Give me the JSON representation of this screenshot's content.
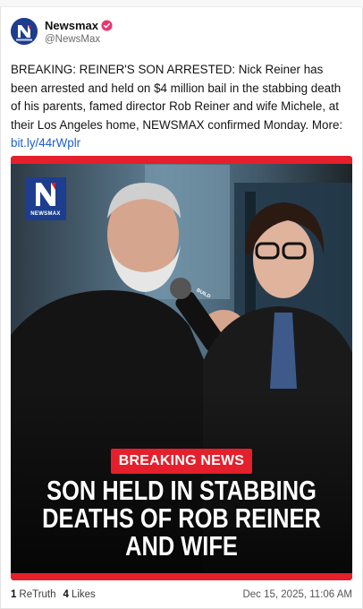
{
  "account": {
    "display_name": "Newsmax",
    "handle": "@NewsMax",
    "avatar_icon": "newsmax-n-logo",
    "verified_icon": "verified-badge-icon",
    "brand_color": "#1d3d8f",
    "verified_color": "#e8366f"
  },
  "post": {
    "text": "BREAKING: REINER'S SON ARRESTED: Nick Reiner has been arrested and held on $4 million bail in the stabbing death of his parents, famed director Rob Reiner and wife Michele, at their Los Angeles home, NEWSMAX confirmed Monday. More:",
    "link": "bit.ly/44rWplr",
    "link_color": "#1f5fd1"
  },
  "media": {
    "logo_text": "NEWSMAX",
    "mic_text": "BUILD",
    "badge": "BREAKING NEWS",
    "headline_lines": [
      "SON HELD IN STABBING",
      "DEATHS OF ROB REINER",
      "AND WIFE"
    ],
    "accent_color": "#e51f2b"
  },
  "footer": {
    "retruths_count": "1",
    "retruths_label": "ReTruth",
    "likes_count": "4",
    "likes_label": "Likes",
    "timestamp": "Dec 15, 2025, 11:06 AM"
  }
}
